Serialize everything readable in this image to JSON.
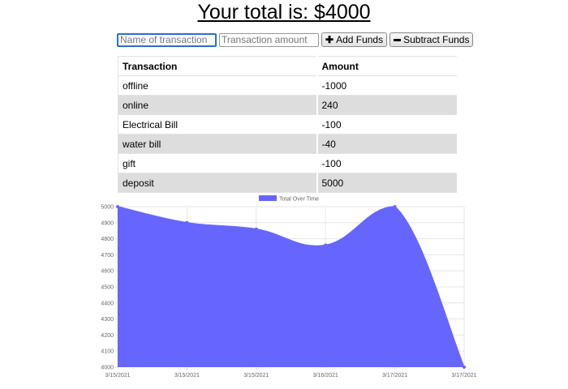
{
  "header": {
    "title": "Your total is: $4000"
  },
  "form": {
    "name_placeholder": "Name of transaction",
    "amount_placeholder": "Transaction amount",
    "add_label": "Add Funds",
    "subtract_label": "Subtract Funds"
  },
  "table": {
    "headers": [
      "Transaction",
      "Amount"
    ],
    "rows": [
      [
        "offline",
        "-1000"
      ],
      [
        "online",
        "240"
      ],
      [
        "Electrical Bill",
        "-100"
      ],
      [
        "water bill",
        "-40"
      ],
      [
        "gift",
        "-100"
      ],
      [
        "deposit",
        "5000"
      ]
    ]
  },
  "colors": {
    "area_fill": "#6666ff",
    "grid": "#e6e6e6",
    "active_input_border": "#2a6fd1"
  },
  "chart_data": {
    "type": "area",
    "series": [
      {
        "name": "Total Over Time",
        "values": [
          5000,
          4900,
          4860,
          4760,
          5000,
          4000
        ]
      }
    ],
    "categories": [
      "3/15/2021",
      "3/15/2021",
      "3/15/2021",
      "3/16/2021",
      "3/17/2021",
      "3/17/2021"
    ],
    "y_ticks": [
      5000,
      4900,
      4800,
      4700,
      4600,
      4500,
      4400,
      4300,
      4200,
      4100,
      4000
    ],
    "ylim": [
      4000,
      5000
    ],
    "grid": true,
    "legend": "top-center"
  }
}
